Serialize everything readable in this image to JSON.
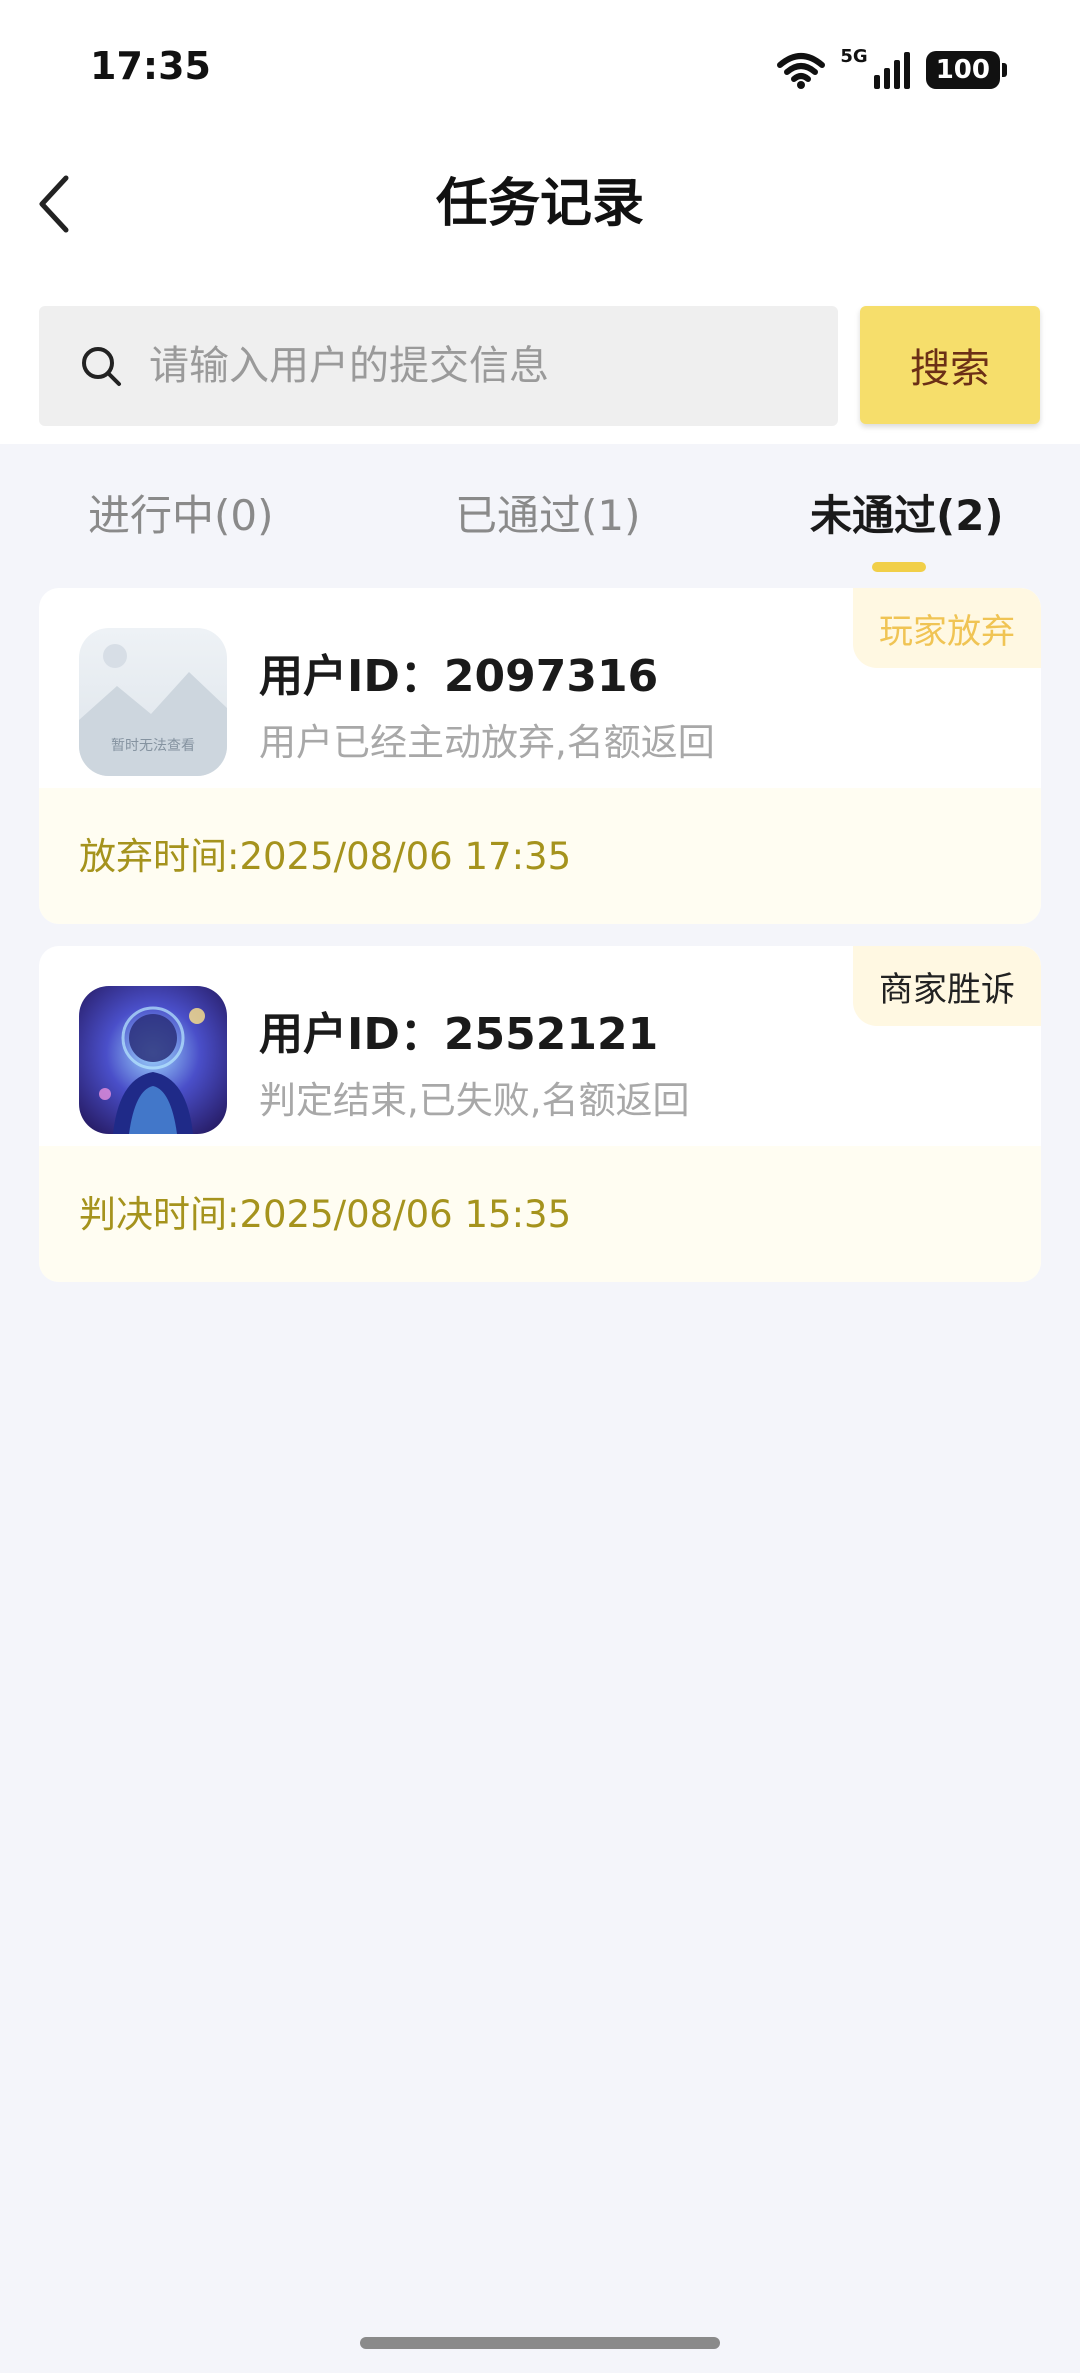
{
  "status_bar": {
    "time": "17:35",
    "network": "5G",
    "battery": "100"
  },
  "header": {
    "title": "任务记录",
    "back_icon": "chevron-left-icon"
  },
  "search": {
    "placeholder": "请输入用户的提交信息",
    "button_label": "搜索",
    "icon": "search-icon"
  },
  "tabs": [
    {
      "label": "进行中(0)",
      "active": false
    },
    {
      "label": "已通过(1)",
      "active": false
    },
    {
      "label": "未通过(2)",
      "active": true
    }
  ],
  "records": [
    {
      "user_id": "用户ID：2097316",
      "description": "用户已经主动放弃,名额返回",
      "tag": "玩家放弃",
      "time": "放弃时间:2025/08/06 17:35",
      "avatar_text": "暂时无法查看"
    },
    {
      "user_id": "用户ID：2552121",
      "description": "判定结束,已失败,名额返回",
      "tag": "商家胜诉",
      "time": "判决时间:2025/08/06 15:35"
    }
  ],
  "colors": {
    "accent": "#f6de6b",
    "accent_text": "#6b2f16",
    "tab_indicator": "#f1cf48",
    "time_text": "#a5931d",
    "background": "#f4f5fa"
  }
}
